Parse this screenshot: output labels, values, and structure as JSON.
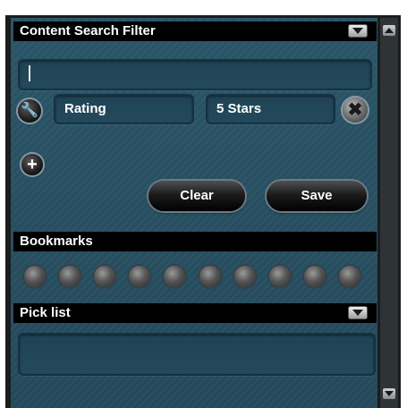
{
  "content_filter": {
    "title": "Content Search Filter",
    "search": {
      "value": "",
      "placeholder": ""
    },
    "criteria": {
      "field": "Rating",
      "value": "5 Stars"
    }
  },
  "actions": {
    "clear_label": "Clear",
    "save_label": "Save"
  },
  "bookmarks": {
    "title": "Bookmarks",
    "slots": 10
  },
  "pick_list": {
    "title": "Pick list",
    "items": []
  },
  "icons": {
    "dropdown": "chevron-down-icon",
    "criteria_type": "wrench-icon",
    "remove": "close-icon",
    "add": "plus-icon",
    "bookmark": "bookmark-slot-icon"
  }
}
